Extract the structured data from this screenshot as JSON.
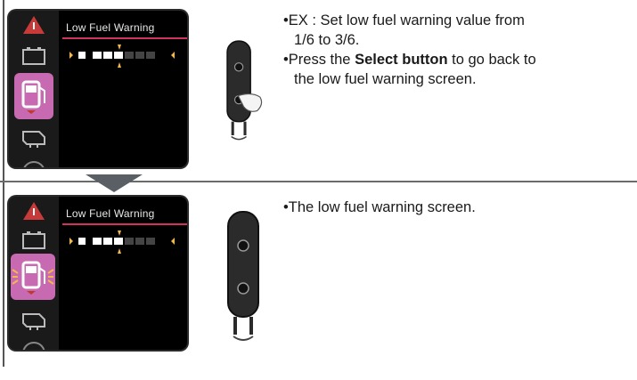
{
  "panel1": {
    "screen_title": "Low Fuel Warning",
    "bullets": {
      "b1_line1": "•EX : Set low fuel warning value from",
      "b1_line2": "1/6 to 3/6.",
      "b2_prefix": "•Press the ",
      "b2_bold": "Select button",
      "b2_suffix": " to go back to",
      "b2_line2": "the low fuel warning screen."
    }
  },
  "panel2": {
    "screen_title": "Low Fuel Warning",
    "bullets": {
      "b1": "•The low fuel warning screen."
    }
  },
  "icons": [
    "warning-icon",
    "battery-icon",
    "fuel-pump-icon",
    "engine-icon",
    "gauge-icon",
    "remote-control-icon",
    "down-arrow-icon"
  ],
  "colors": {
    "highlight": "#c76ab2",
    "accent_line": "#d0335e",
    "screen_bg": "#000000"
  }
}
